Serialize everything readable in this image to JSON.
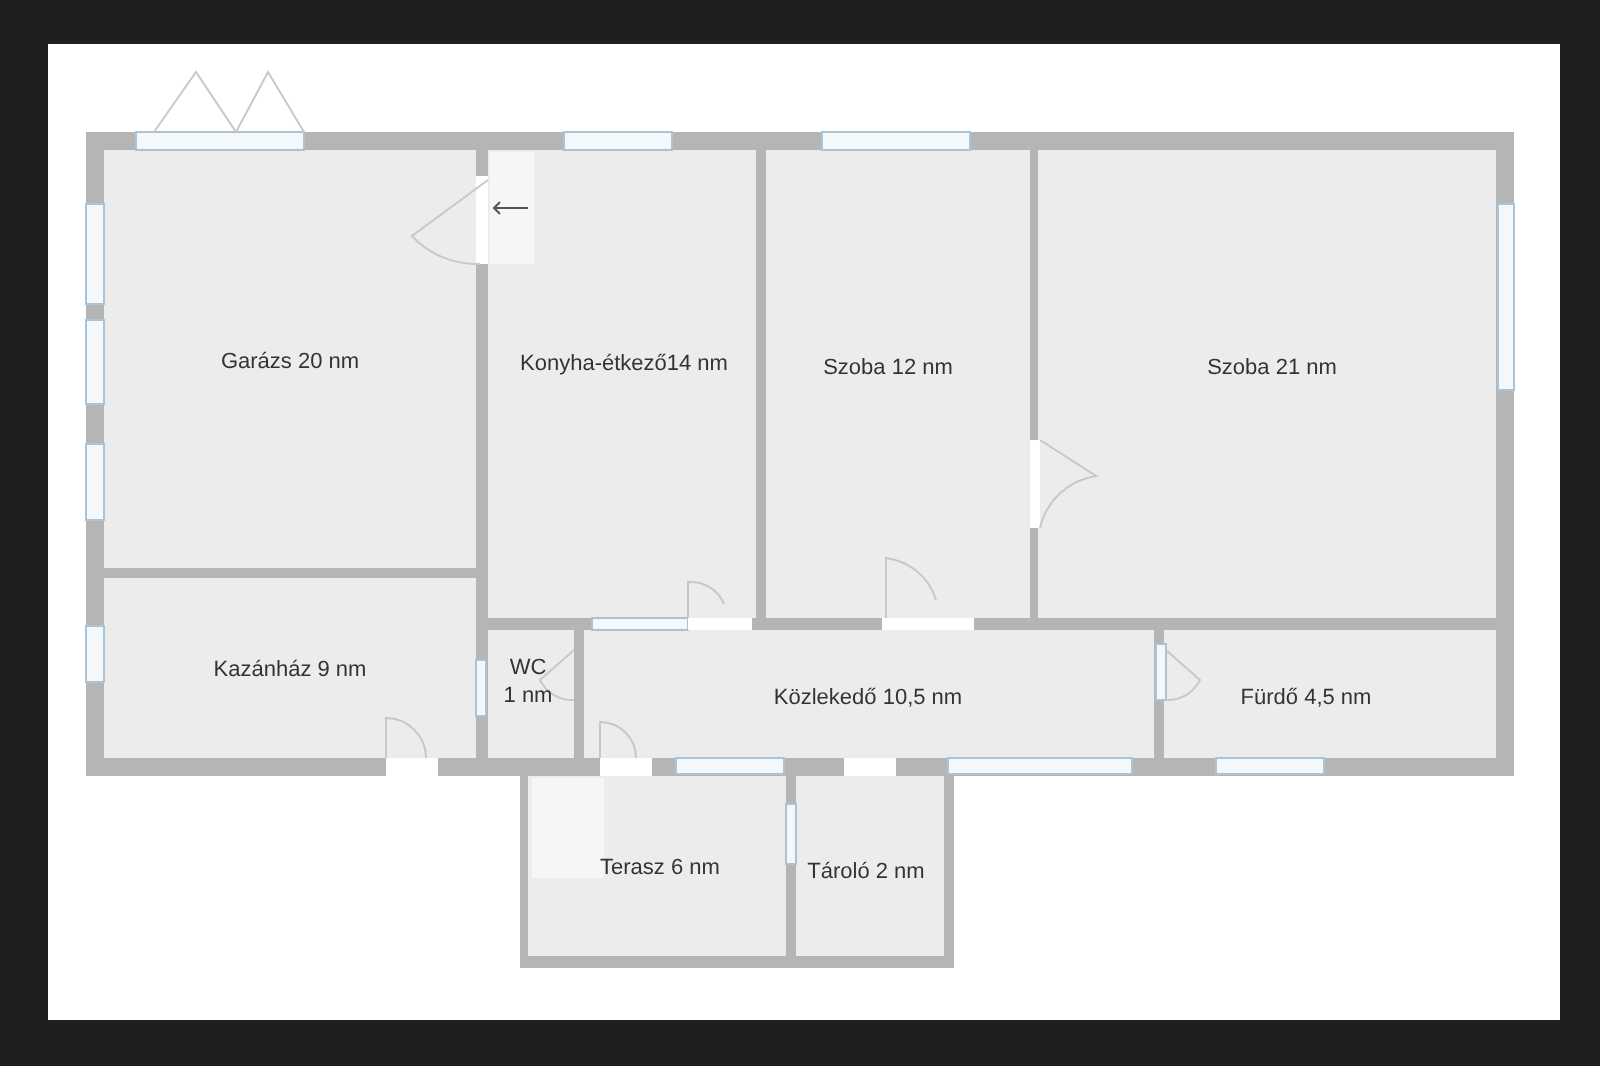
{
  "floor_plan": {
    "rooms": [
      {
        "lines": [
          "Garázs 20 nm"
        ]
      },
      {
        "lines": [
          "Konyha-étkező14 nm"
        ]
      },
      {
        "lines": [
          "Szoba 12 nm"
        ]
      },
      {
        "lines": [
          "Szoba 21 nm"
        ]
      },
      {
        "lines": [
          "Kazánház 9 nm"
        ]
      },
      {
        "lines": [
          "WC",
          "1 nm"
        ]
      },
      {
        "lines": [
          "Közlekedő 10,5 nm"
        ]
      },
      {
        "lines": [
          "Fürdő 4,5 nm"
        ]
      },
      {
        "lines": [
          "Terasz 6 nm"
        ]
      },
      {
        "lines": [
          "Tároló 2 nm"
        ]
      }
    ]
  }
}
